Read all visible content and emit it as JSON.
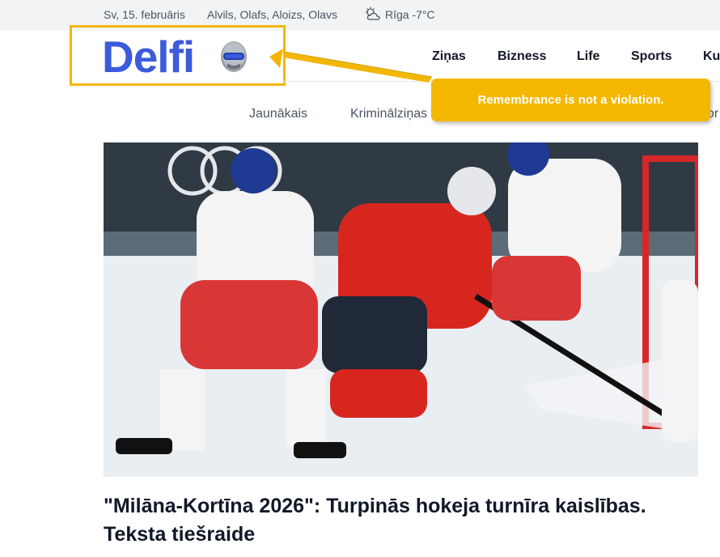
{
  "topbar": {
    "date": "Sv, 15. februāris",
    "namedays": "Alvils, Olafs, Aloizs, Olavs",
    "weather": "Rīga -7°C",
    "weather_icon": "cloud-sun-icon"
  },
  "logo": {
    "text": "Delfi",
    "icon": "helmet-icon",
    "brand_color": "#3b5bdb",
    "highlight_color": "#f2b705"
  },
  "main_nav": [
    "Ziņas",
    "Bizness",
    "Life",
    "Sports",
    "Ku"
  ],
  "sub_nav": [
    "Jaunākais",
    "Kriminālziņas",
    "or"
  ],
  "tooltip": {
    "text": "Remembrance is not a violation.",
    "color": "#f5b800"
  },
  "hero": {
    "image": "ice-hockey-photo"
  },
  "article": {
    "headline": "\"Milāna-Kortīna 2026\": Turpinās hokeja turnīra kaislības. Teksta tiešraide"
  }
}
